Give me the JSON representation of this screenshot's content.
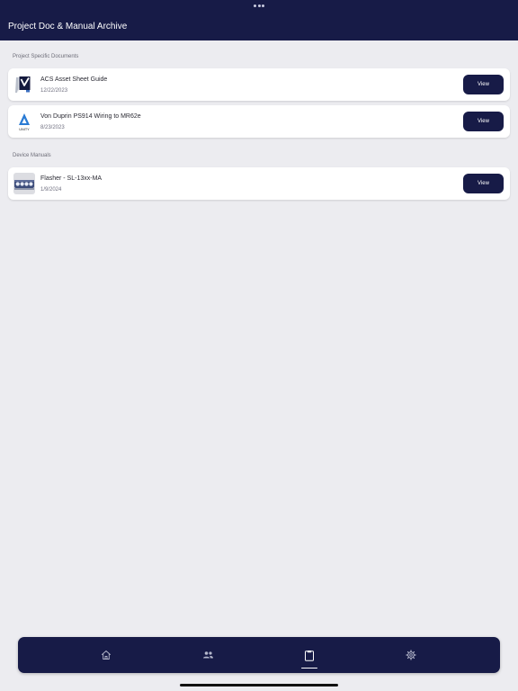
{
  "header": {
    "title": "Project Doc & Manual Archive"
  },
  "sections": {
    "project": {
      "label": "Project Specific Documents",
      "items": [
        {
          "title": "ACS Asset Sheet Guide",
          "date": "12/22/2023",
          "button": "View",
          "icon": "acs-logo-icon"
        },
        {
          "title": "Von Duprin PS914 Wiring to MR62e",
          "date": "8/23/2023",
          "button": "View",
          "icon": "unity-logo-icon",
          "logo_text": "UNITY"
        }
      ]
    },
    "devices": {
      "label": "Device Manuals",
      "items": [
        {
          "title": "Flasher - SL-13xx-MA",
          "date": "1/9/2024",
          "button": "View",
          "icon": "flasher-device-icon"
        }
      ]
    }
  },
  "tabbar": {
    "tabs": [
      {
        "icon": "home-icon",
        "active": false
      },
      {
        "icon": "people-icon",
        "active": false
      },
      {
        "icon": "clipboard-icon",
        "active": true
      },
      {
        "icon": "gear-icon",
        "active": false
      }
    ]
  },
  "colors": {
    "navy": "#171b47",
    "background": "#ececf0",
    "card": "#ffffff",
    "accent_blue": "#2a7bd4"
  }
}
